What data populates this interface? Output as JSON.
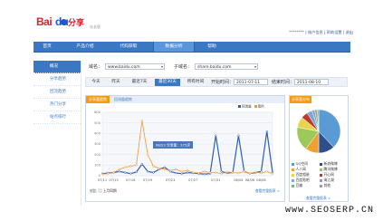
{
  "header": {
    "logo_text_bai": "Bai",
    "logo_text_du": "du",
    "logo_product": "分享",
    "logo_sub": "站长版",
    "user_name": "********",
    "user_links": "| 账户信息 | 帮助设置 | 退出"
  },
  "nav": {
    "items": [
      {
        "label": "首页",
        "active": false
      },
      {
        "label": "产品介绍",
        "active": false
      },
      {
        "label": "代码获取",
        "active": false
      },
      {
        "label": "数据分析",
        "active": true
      },
      {
        "label": "帮助",
        "active": false
      }
    ]
  },
  "sidebar": {
    "items": [
      {
        "label": "概况",
        "active": true
      },
      {
        "label": "分享趋势",
        "active": false
      },
      {
        "label": "回流趋势",
        "active": false
      },
      {
        "label": "热门分享",
        "active": false
      },
      {
        "label": "站点排行",
        "active": false
      }
    ]
  },
  "filters": {
    "domain_label": "域名：",
    "domain_value": "www.baidu.com",
    "subdomain_label": "子域名：",
    "subdomain_value": "share.baidu.com"
  },
  "range": {
    "buttons": [
      {
        "label": "今天",
        "active": false
      },
      {
        "label": "昨天",
        "active": false
      },
      {
        "label": "最近7天",
        "active": false
      },
      {
        "label": "最近30天",
        "active": true
      },
      {
        "label": "所有时间",
        "active": false
      }
    ],
    "start_label": "开始时间：",
    "start_value": "2011-07-11",
    "end_label": "结束时间：",
    "end_value": "2011-08-10"
  },
  "chart_tabs": [
    {
      "label": "分享量趋势",
      "active": true
    },
    {
      "label": "回流量趋势",
      "active": false
    }
  ],
  "chart_legend": {
    "series1": "回流量",
    "series2": "图片"
  },
  "tooltip": "08/23 分享量：275次",
  "chart_footer": {
    "compare_label": "对比",
    "compare_checkbox": "上月同期",
    "more_link": "查看完整报表 >"
  },
  "pie_tab": "分享量分布",
  "pie_footer_link": "查看完整报表 >",
  "pie_legend": [
    {
      "label": "QQ空间",
      "color": "#5b9bd5"
    },
    {
      "label": "新浪微博",
      "color": "#2f4f8a"
    },
    {
      "label": "人人网",
      "color": "#f0a030"
    },
    {
      "label": "腾讯微博",
      "color": "#9dc85a"
    },
    {
      "label": "百度相册",
      "color": "#e8d44d"
    },
    {
      "label": "开心网",
      "color": "#c0392b"
    },
    {
      "label": "百度贴吧",
      "color": "#74a9d8"
    },
    {
      "label": "淘江湖",
      "color": "#a68bc0"
    },
    {
      "label": "豆瓣",
      "color": "#7fb77e"
    },
    {
      "label": "其他",
      "color": "#999999"
    }
  ],
  "watermark": "www.SEOSERP.CN",
  "chart_data": {
    "type": "line",
    "x": [
      "07/11",
      "07/12",
      "07/13",
      "07/14",
      "07/15",
      "07/16",
      "07/17",
      "07/18",
      "07/19",
      "07/20",
      "07/21",
      "07/22",
      "07/23",
      "07/24",
      "07/25",
      "07/26",
      "07/27",
      "07/28",
      "07/29",
      "07/30",
      "07/31",
      "08/01",
      "08/02",
      "08/03",
      "08/04",
      "08/05",
      "08/06",
      "08/07",
      "08/08",
      "08/09",
      "08/10"
    ],
    "x_tick_labels": [
      "07/11",
      "07/13",
      "07/16",
      "07/19",
      "07/23",
      "07/27",
      "07/31",
      "08/04",
      "08/06",
      "08/08"
    ],
    "y_tick_labels": [
      "600",
      "500",
      "400",
      "300",
      "200",
      "100",
      "0"
    ],
    "ylim": [
      0,
      600
    ],
    "series": [
      {
        "name": "回流量",
        "color": "#2e5fb0",
        "values": [
          20,
          25,
          30,
          40,
          30,
          20,
          35,
          110,
          40,
          30,
          60,
          80,
          40,
          25,
          20,
          30,
          25,
          20,
          15,
          20,
          380,
          40,
          25,
          30,
          380,
          40,
          20,
          30,
          40,
          420,
          30
        ]
      },
      {
        "name": "图片",
        "color": "#f0963a",
        "values": [
          15,
          20,
          30,
          60,
          80,
          90,
          100,
          520,
          200,
          90,
          70,
          60,
          50,
          60,
          40,
          50,
          30,
          25,
          40,
          30,
          30,
          20,
          35,
          30,
          25,
          40,
          20,
          35,
          25,
          40,
          20
        ]
      }
    ],
    "pie": {
      "type": "pie",
      "categories": [
        "QQ空间",
        "新浪微博",
        "人人网",
        "腾讯微博",
        "百度相册",
        "开心网",
        "百度贴吧",
        "淘江湖",
        "豆瓣",
        "其他"
      ],
      "values": [
        38,
        12,
        10,
        18,
        8,
        5,
        4,
        2,
        2,
        1
      ]
    }
  }
}
